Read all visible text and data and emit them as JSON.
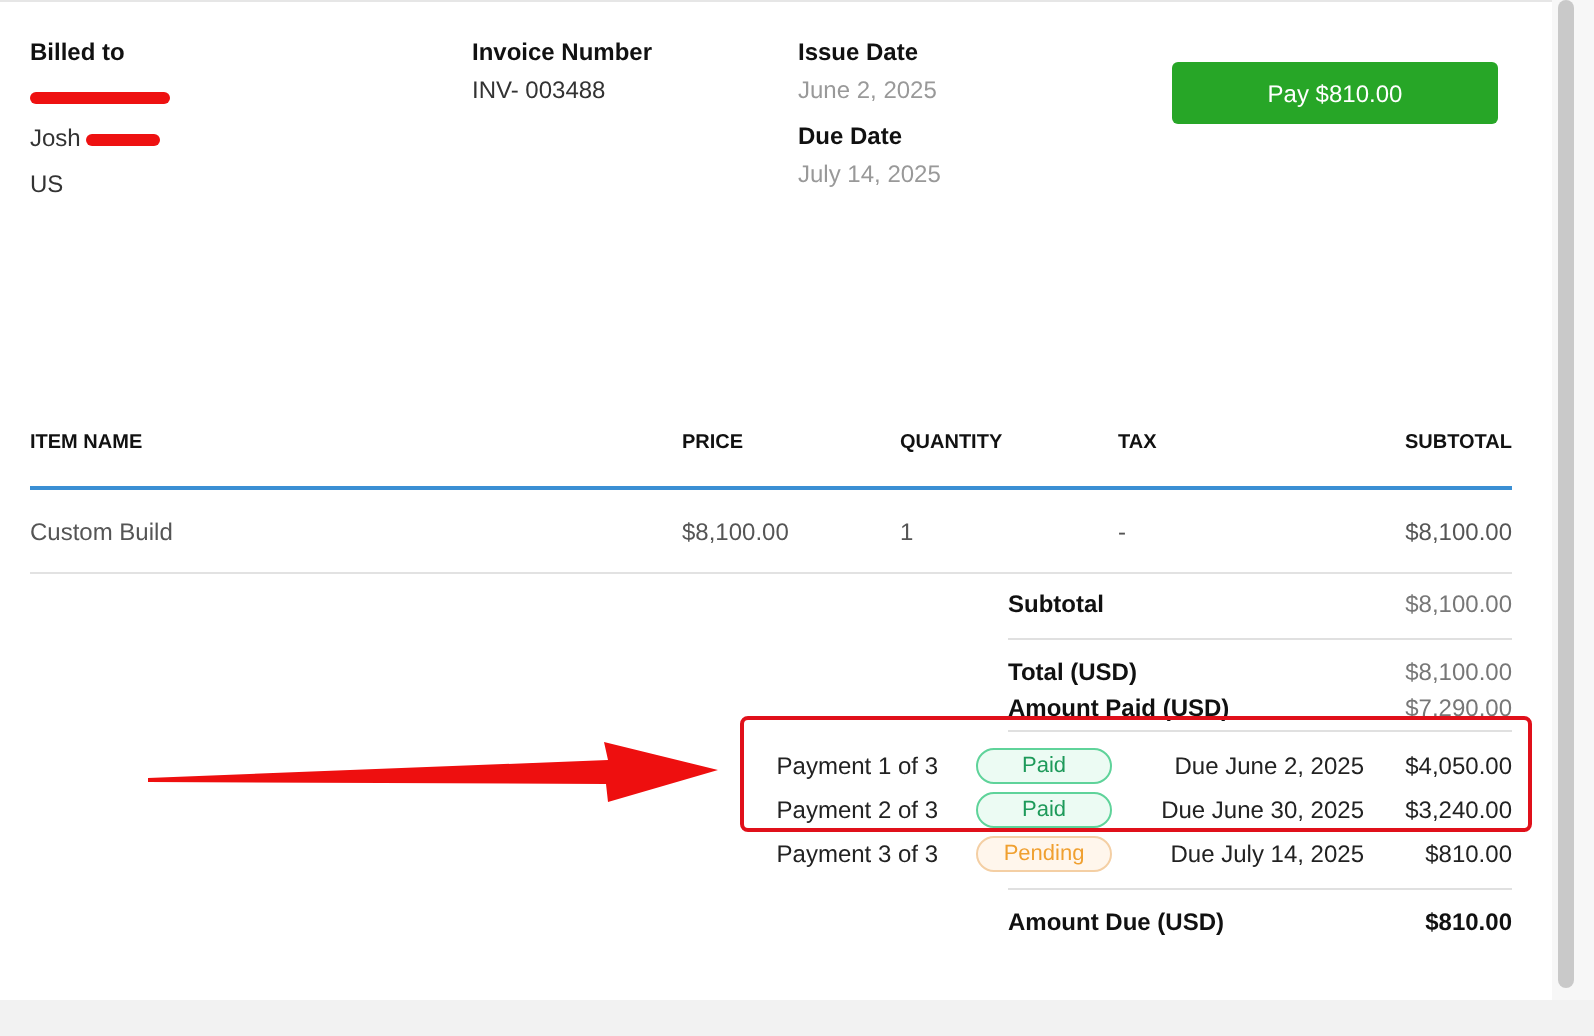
{
  "billing": {
    "label": "Billed to",
    "lines": [
      "Josh",
      "US"
    ]
  },
  "invoice_number": {
    "label": "Invoice Number",
    "value": "INV- 003488"
  },
  "issue_date": {
    "label": "Issue Date",
    "value": "June 2, 2025"
  },
  "due_date": {
    "label": "Due Date",
    "value": "July 14, 2025"
  },
  "pay_button": "Pay $810.00",
  "table": {
    "columns": [
      "ITEM NAME",
      "PRICE",
      "QUANTITY",
      "TAX",
      "SUBTOTAL"
    ],
    "rows": [
      [
        "Custom Build",
        "$8,100.00",
        "1",
        "-",
        "$8,100.00"
      ]
    ]
  },
  "summary": {
    "subtotal": {
      "label": "Subtotal",
      "value": "$8,100.00"
    },
    "total": {
      "label": "Total (USD)",
      "value": "$8,100.00"
    },
    "amount_paid": {
      "label": "Amount Paid (USD)",
      "value": "$7,290.00"
    },
    "payments": [
      {
        "label": "Payment 1 of 3",
        "kind": "paid",
        "status": "Paid",
        "due": "Due June 2, 2025",
        "amount": "$4,050.00"
      },
      {
        "label": "Payment 2 of 3",
        "kind": "paid",
        "status": "Paid",
        "due": "Due June 30, 2025",
        "amount": "$3,240.00"
      },
      {
        "label": "Payment 3 of 3",
        "kind": "pending",
        "status": "Pending",
        "due": "Due July 14, 2025",
        "amount": "$810.00"
      }
    ],
    "amount_due": {
      "label": "Amount Due (USD)",
      "value": "$810.00"
    }
  }
}
